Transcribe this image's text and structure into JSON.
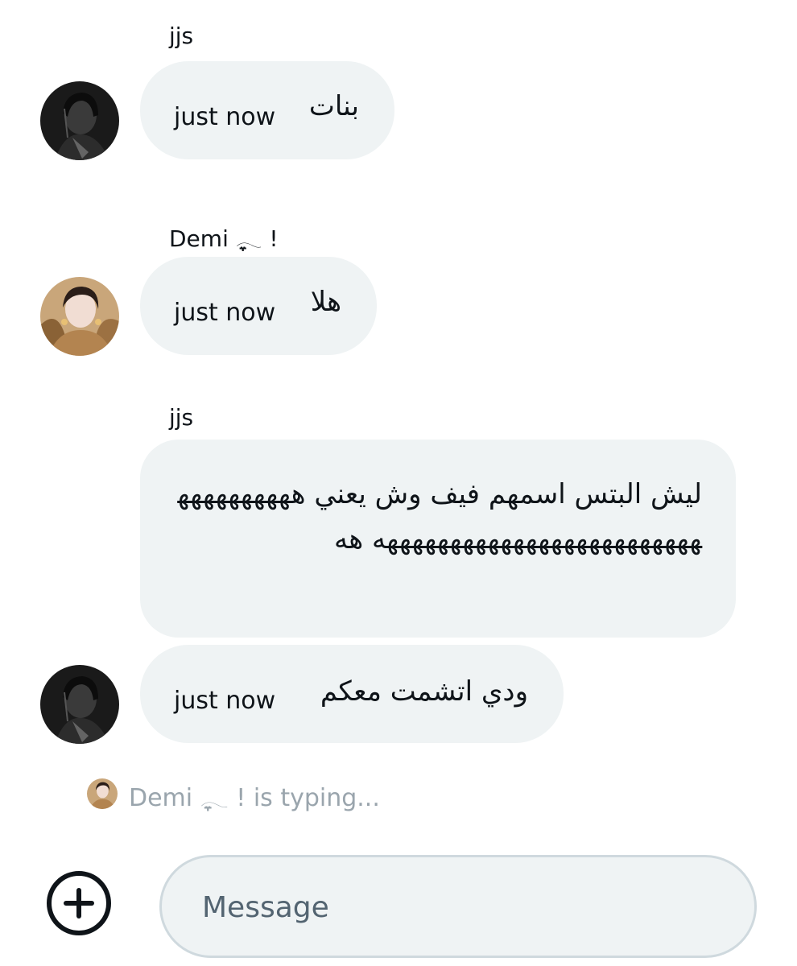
{
  "messages": [
    {
      "sender": "jjs",
      "time": "just now",
      "text": "بنات"
    },
    {
      "sender": "Demi ִֶָ𓂃 !",
      "time": "just now",
      "text": "هلا"
    },
    {
      "sender": "jjs",
      "text": "ليش البتس اسمهم فيف وش يعني هههههههههههههههههههههههههههههههههههه هه"
    },
    {
      "time": "just now",
      "text": "ودي اتشمت معكم"
    }
  ],
  "typing_indicator": "Demi ִֶָ𓂃 ! is typing...",
  "composer": {
    "placeholder": "Message"
  },
  "icons": {
    "add": "plus-circle-icon"
  },
  "colors": {
    "bubble": "#eff3f4",
    "text": "#0f1419",
    "muted": "#9aa5ad",
    "placeholder": "#536471"
  }
}
